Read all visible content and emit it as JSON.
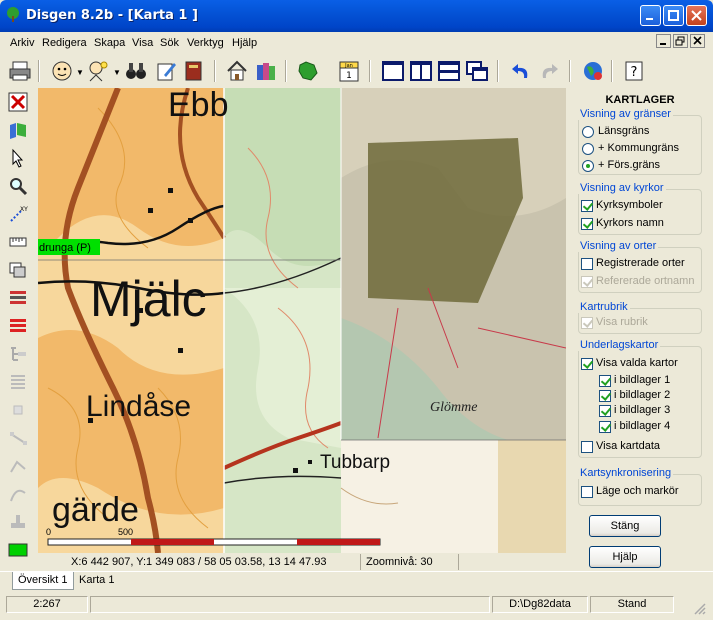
{
  "window": {
    "title": "Disgen 8.2b - [Karta 1 ]"
  },
  "menu": [
    "Arkiv",
    "Redigera",
    "Skapa",
    "Visa",
    "Sök",
    "Verktyg",
    "Hjälp"
  ],
  "map": {
    "labels": {
      "ebb": "Ebb",
      "mjalc": "Mjälc",
      "lindase": "Lindåse",
      "garde": "gärde",
      "tubbarp": "Tubbarp",
      "glomme": "Glömme",
      "parish_tag": "drunga (P)"
    },
    "scale": {
      "zero": "0",
      "mid": "500"
    }
  },
  "panel": {
    "title": "KARTLAGER",
    "groups": {
      "granser": {
        "title": "Visning av gränser",
        "items": [
          {
            "label": "Länsgräns",
            "checked": false
          },
          {
            "label": "+ Kommungräns",
            "checked": false
          },
          {
            "label": "+ Förs.gräns",
            "checked": true
          }
        ]
      },
      "kyrkor": {
        "title": "Visning av kyrkor",
        "items": [
          {
            "label": "Kyrksymboler",
            "checked": true
          },
          {
            "label": "Kyrkors namn",
            "checked": true
          }
        ]
      },
      "orter": {
        "title": "Visning av orter",
        "items": [
          {
            "label": "Registrerade orter",
            "checked": false
          },
          {
            "label": "Refererade ortnamn",
            "checked": true,
            "disabled": true
          }
        ]
      },
      "kartrubrik": {
        "title": "Kartrubrik",
        "items": [
          {
            "label": "Visa rubrik",
            "checked": true,
            "disabled": true
          }
        ]
      },
      "underlag": {
        "title": "Underlagskartor",
        "items": [
          {
            "label": "Visa valda kartor",
            "checked": true
          },
          {
            "label": "i bildlager 1",
            "checked": true
          },
          {
            "label": "i bildlager 2",
            "checked": true
          },
          {
            "label": "i bildlager 3",
            "checked": true
          },
          {
            "label": "i bildlager 4",
            "checked": true
          },
          {
            "label": "Visa kartdata",
            "checked": false
          }
        ]
      },
      "synk": {
        "title": "Kartsynkronisering",
        "items": [
          {
            "label": "Läge och markör",
            "checked": false
          }
        ]
      }
    },
    "buttons": {
      "close": "Stäng",
      "help": "Hjälp"
    }
  },
  "coords": {
    "text": "X:6 442 907, Y:1 349 083 / 58 05 03.58, 13 14 47.93",
    "zoom": "Zoomnivå: 30"
  },
  "tabs": [
    "Översikt 1",
    "Karta 1"
  ],
  "status": {
    "count": "2:267",
    "path": "D:\\Dg82data",
    "mode": "Stand"
  },
  "toolbar": {
    "calendar": "Jan 1"
  }
}
